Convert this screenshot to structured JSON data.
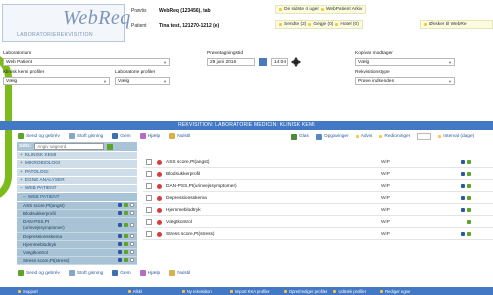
{
  "header": {
    "logo_main": "WebReq",
    "logo_sub": "LABORATORIEREKVISITION",
    "patient_label": "Prøvetidspunkt",
    "patient_label_short": "Prøvts",
    "row1_label": "Prøvtis",
    "row1_value": "WebReq (123456), tab",
    "row2_label": "Patient",
    "row2_value": "Tina test, 121270-1212 (e)",
    "info_items": [
      {
        "text": "De sidste 4 uger",
        "sub": "WebPatient Arkiv"
      },
      {
        "text": "Sendte (2)",
        "sub": "Gegje (0)",
        "extra": "Hotel (0)"
      },
      {
        "text": "Ønsker til WebRe"
      }
    ]
  },
  "form": {
    "laboratorium_label": "Laboratorium",
    "laboratorium_value": "Web Patient",
    "klinik_label": "Klinisk kemi profiler",
    "klinik_value": "Vælg",
    "lab_profiler_label": "Laboratorie profiler",
    "lab_profiler_value": "Vælg",
    "provetagning_label": "Prøvetagningstid",
    "date_value": "29 juni 2016",
    "time_value": "14:04",
    "kopivar_label": "Kopivar modtager",
    "kopivar_value": "Vælg",
    "rekv_label": "Rekvisitionstype",
    "rekv_value": "Prøve indsendes"
  },
  "titlebar": "REKVISITION: LABORATORIE MEDICIN: KLINISK KEMI",
  "toolbar": {
    "send": "Send og gebrév",
    "stoft": "Stoft gisning",
    "gem": "Gem",
    "hjalp": "Hjælp",
    "nulstil": "Nulstil",
    "glas": "Glas",
    "opgaver": "Opgavinger",
    "advis": "Advis",
    "rediger": "Redioninger",
    "interval": "Interval (dage)"
  },
  "search": {
    "label": "SØG:",
    "placeholder": "Angiv søgeord"
  },
  "sidebar": {
    "items": [
      "KLINISK KEMI",
      "MIKROBIOLOGI",
      "PATOLOGI",
      "EGNE ANALYSER",
      "WEB PATIENT"
    ],
    "sub_header": "WEB PATIENT",
    "sub_items": [
      "ASS score,Pt(angst)",
      "Blodsukkerprofil",
      "DAN-PSS,Pt (urinvejssymptomer)",
      "Depressionsskema",
      "Hjemmeblodtryk",
      "Vægtkontrol",
      "Stress score,Pt(stress)"
    ]
  },
  "rows": [
    {
      "name": "ASS score,Pt(angst)",
      "status": "WiP"
    },
    {
      "name": "Blodsukkerprofil",
      "status": "WiP"
    },
    {
      "name": "DAN-PSS,Pt(urinvejssymptomer)",
      "status": "WiP"
    },
    {
      "name": "Depressionsskema",
      "status": "WiP"
    },
    {
      "name": "Hjemmeblodtryk",
      "status": "WiP"
    },
    {
      "name": "Vægtkontrol",
      "status": "WiP"
    },
    {
      "name": "Stress score,Pt(stress)",
      "status": "WiP"
    }
  ],
  "footer": {
    "items": [
      "Support",
      "Afskl",
      "Ny rekvisition",
      "Import KKA profiler",
      "Opret/rediger profiler",
      "Udtræk profiler",
      "Rediger egne"
    ]
  },
  "colors": {
    "titlebar": "#4378c4",
    "accent": "#7dba1b",
    "sidebar": "#cfdde8"
  }
}
